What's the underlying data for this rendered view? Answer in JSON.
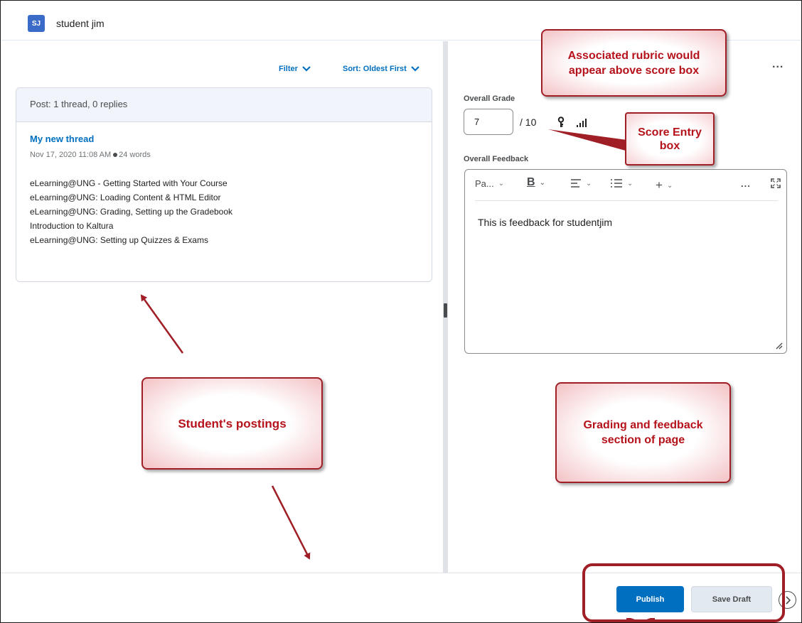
{
  "header": {
    "avatar_initials": "SJ",
    "student_name": "student jim"
  },
  "toolbar": {
    "filter_label": "Filter",
    "sort_label": "Sort: Oldest First"
  },
  "post_card": {
    "summary": "Post: 1 thread, 0 replies",
    "thread_title": "My new thread",
    "date": "Nov 17, 2020 11:08 AM",
    "word_count": "24 words",
    "lines": [
      "eLearning@UNG - Getting Started with Your Course",
      "eLearning@UNG: Loading Content & HTML Editor",
      "eLearning@UNG:  Grading, Setting up the Gradebook",
      "Introduction to Kaltura",
      "eLearning@UNG: Setting up Quizzes & Exams"
    ]
  },
  "grading": {
    "more_menu": "...",
    "overall_grade_label": "Overall Grade",
    "score_value": "7",
    "score_out_of": "/ 10",
    "overall_feedback_label": "Overall Feedback",
    "editor": {
      "paragraph_label": "Pa...",
      "bold_label": "B",
      "insert_label": "+",
      "more_label": "...",
      "content": "This is feedback for studentjim"
    }
  },
  "footer": {
    "publish_label": "Publish",
    "save_draft_label": "Save Draft"
  },
  "callouts": {
    "rubric": "Associated rubric would appear above score box",
    "score_entry": "Score Entry box",
    "postings": "Student's postings",
    "grading": "Grading and feedback section of page"
  },
  "colors": {
    "accent": "#006fbf",
    "callout_red": "#a01e26",
    "avatar_blue": "#3a6bc9"
  },
  "icons": {
    "filter_chevron": "chevron-down-icon",
    "sort_chevron": "chevron-down-icon",
    "key": "key-icon",
    "stats": "stats-icon",
    "align": "align-left-icon",
    "list": "list-icon",
    "fullscreen": "fullscreen-icon",
    "next": "chevron-right-icon"
  }
}
